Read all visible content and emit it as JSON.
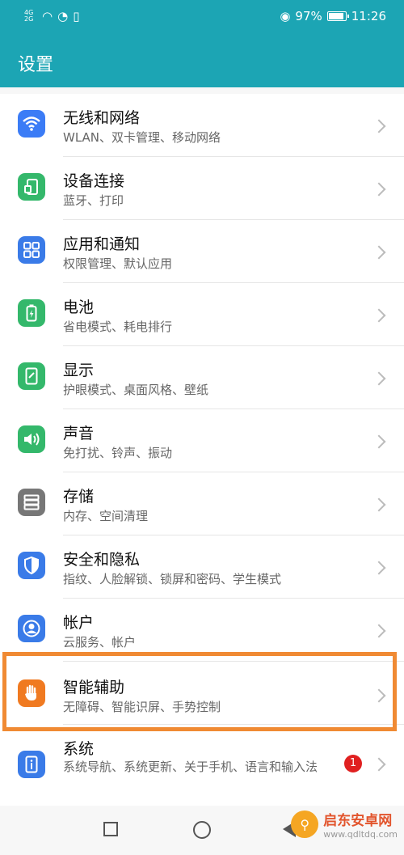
{
  "status": {
    "signal1": "4G",
    "signal2": "2G",
    "battery": "97%",
    "time": "11:26"
  },
  "header": {
    "title": "设置"
  },
  "settings": [
    {
      "title": "无线和网络",
      "subtitle": "WLAN、双卡管理、移动网络",
      "icon": "wifi-icon",
      "color": "#3b7cf6"
    },
    {
      "title": "设备连接",
      "subtitle": "蓝牙、打印",
      "icon": "device-connection-icon",
      "color": "#34b86b"
    },
    {
      "title": "应用和通知",
      "subtitle": "权限管理、默认应用",
      "icon": "apps-grid-icon",
      "color": "#3a7be8"
    },
    {
      "title": "电池",
      "subtitle": "省电模式、耗电排行",
      "icon": "battery-icon",
      "color": "#34b86b"
    },
    {
      "title": "显示",
      "subtitle": "护眼模式、桌面风格、壁纸",
      "icon": "display-icon",
      "color": "#34b86b"
    },
    {
      "title": "声音",
      "subtitle": "免打扰、铃声、振动",
      "icon": "sound-icon",
      "color": "#34b86b"
    },
    {
      "title": "存储",
      "subtitle": "内存、空间清理",
      "icon": "storage-icon",
      "color": "#777777"
    },
    {
      "title": "安全和隐私",
      "subtitle": "指纹、人脸解锁、锁屏和密码、学生模式",
      "icon": "shield-icon",
      "color": "#3a7be8"
    },
    {
      "title": "帐户",
      "subtitle": "云服务、帐户",
      "icon": "account-icon",
      "color": "#3a7be8"
    },
    {
      "title": "智能辅助",
      "subtitle": "无障碍、智能识屏、手势控制",
      "icon": "hand-icon",
      "color": "#f07a21"
    },
    {
      "title": "系统",
      "subtitle": "系统导航、系统更新、关于手机、语言和输入法",
      "icon": "system-info-icon",
      "color": "#3a7be8",
      "badge": "1"
    }
  ],
  "watermark": {
    "title": "启东安卓网",
    "url": "www.qdltdq.com"
  }
}
